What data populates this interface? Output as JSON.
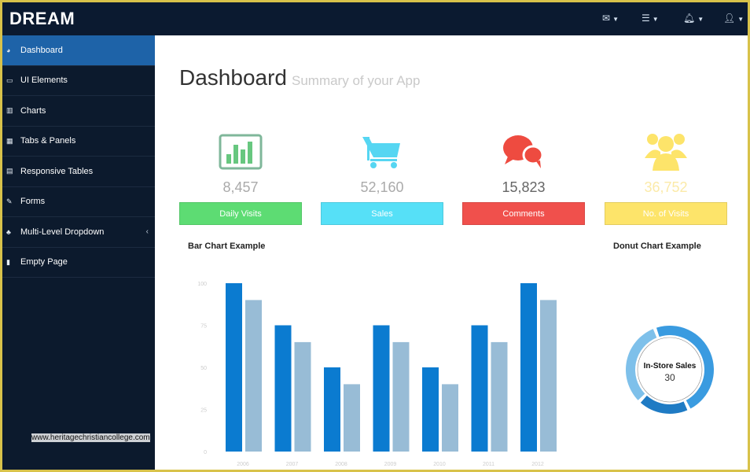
{
  "brand": "DREAM",
  "topbar": {
    "icons": [
      "envelope-icon",
      "tasks-icon",
      "bell-icon",
      "user-icon"
    ]
  },
  "sidebar": {
    "items": [
      {
        "label": "Dashboard",
        "icon": "dashboard-icon",
        "active": true
      },
      {
        "label": "UI Elements",
        "icon": "desktop-icon"
      },
      {
        "label": "Charts",
        "icon": "bar-chart-icon"
      },
      {
        "label": "Tabs & Panels",
        "icon": "qrcode-icon"
      },
      {
        "label": "Responsive Tables",
        "icon": "table-icon"
      },
      {
        "label": "Forms",
        "icon": "edit-icon"
      },
      {
        "label": "Multi-Level Dropdown",
        "icon": "sitemap-icon",
        "chevron": "‹"
      },
      {
        "label": "Empty Page",
        "icon": "file-icon"
      }
    ]
  },
  "page": {
    "title": "Dashboard",
    "subtitle": "Summary of your App"
  },
  "cards": [
    {
      "value": "8,457",
      "label": "Daily Visits",
      "color": "#5ddc73",
      "icon": "bar-chart-icon"
    },
    {
      "value": "52,160",
      "label": "Sales",
      "color": "#56e0f7",
      "icon": "shopping-cart-icon"
    },
    {
      "value": "15,823",
      "label": "Comments",
      "color": "#f0504c",
      "icon": "comments-icon"
    },
    {
      "value": "36,752",
      "label": "No. of Visits",
      "color": "#fde46a",
      "icon": "users-icon"
    }
  ],
  "chart_data": [
    {
      "type": "bar",
      "title": "Bar Chart Example",
      "categories": [
        "2006",
        "2007",
        "2008",
        "2009",
        "2010",
        "2011",
        "2012"
      ],
      "series": [
        {
          "values": [
            100,
            75,
            50,
            75,
            50,
            75,
            100
          ],
          "color": "#0b7bd0"
        },
        {
          "values": [
            90,
            65,
            40,
            65,
            40,
            65,
            90
          ],
          "color": "#98bcd6"
        }
      ],
      "yticks": [
        "0",
        "25",
        "50",
        "75",
        "100"
      ],
      "ylim": [
        0,
        100
      ]
    },
    {
      "type": "pie",
      "title": "Donut Chart Example",
      "center_label": "In-Store Sales",
      "center_value": "30",
      "values": [
        30,
        12,
        20
      ],
      "colors": [
        "#3a9be0",
        "#1f7bc4",
        "#7ec0ea"
      ]
    }
  ],
  "watermark": "www.heritagechristiancollege.com"
}
